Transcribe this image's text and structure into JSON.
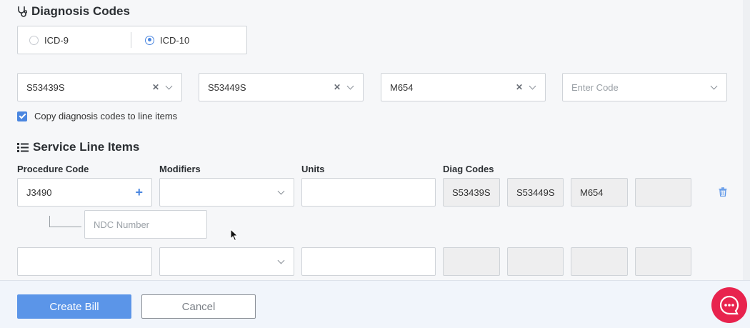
{
  "diagnosis": {
    "title": "Diagnosis Codes",
    "code_type": {
      "options": [
        "ICD-9",
        "ICD-10"
      ],
      "selected": "ICD-10"
    },
    "codes": [
      {
        "value": "S53439S",
        "clearable": true
      },
      {
        "value": "S53449S",
        "clearable": true
      },
      {
        "value": "M654",
        "clearable": true
      }
    ],
    "enter_code_placeholder": "Enter Code",
    "copy_label": "Copy diagnosis codes to line items",
    "copy_checked": true
  },
  "service": {
    "title": "Service Line Items",
    "headers": {
      "procedure": "Procedure Code",
      "modifiers": "Modifiers",
      "units": "Units",
      "diag": "Diag Codes"
    },
    "rows": [
      {
        "procedure": "J3490",
        "modifiers": "",
        "units": "",
        "diag": [
          "S53439S",
          "S53449S",
          "M654",
          ""
        ],
        "ndc_placeholder": "NDC Number"
      },
      {
        "procedure": "",
        "modifiers": "",
        "units": "",
        "diag": [
          "",
          "",
          "",
          ""
        ]
      }
    ]
  },
  "footer": {
    "create_label": "Create Bill",
    "cancel_label": "Cancel"
  },
  "icons": {
    "stethoscope": "stethoscope-icon",
    "list": "list-icon",
    "trash": "trash-icon",
    "chat": "chat-icon",
    "plus": "plus-icon"
  },
  "colors": {
    "accent": "#4a86e0",
    "button": "#5b95e8",
    "chat": "#e8234e"
  }
}
